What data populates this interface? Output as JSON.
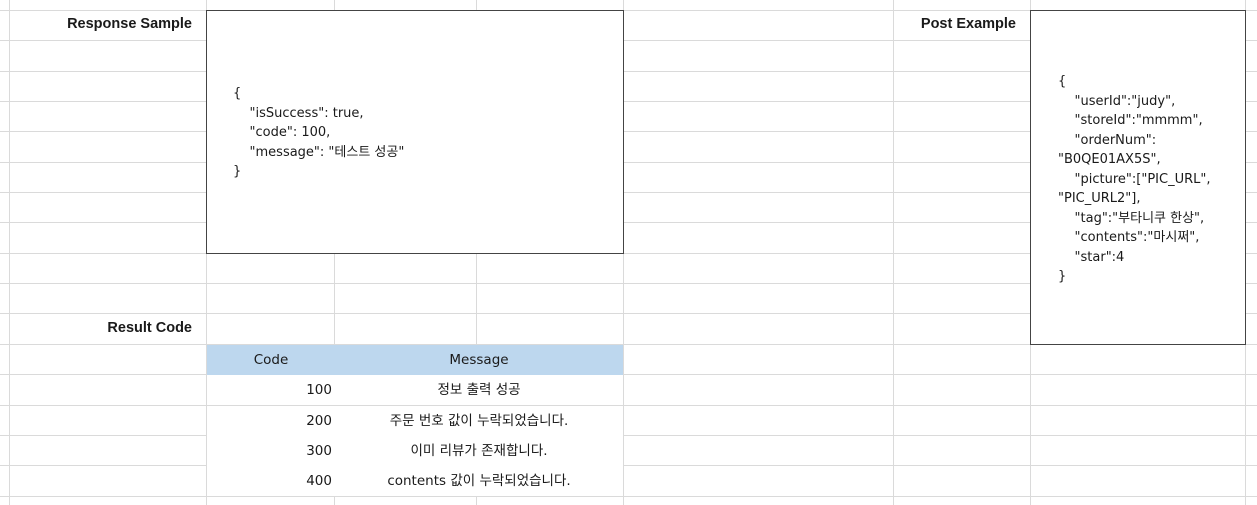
{
  "response_sample": {
    "label": "Response Sample",
    "json_text": "{\n    \"isSuccess\": true,\n    \"code\": 100,\n    \"message\": \"테스트 성공\"\n}"
  },
  "post_example": {
    "label": "Post Example",
    "json_text": "{\n    \"userId\":\"judy\",\n    \"storeId\":\"mmmm\",\n    \"orderNum\":\n\"B0QE01AX5S\",\n    \"picture\":[\"PIC_URL\",\n\"PIC_URL2\"],\n    \"tag\":\"부타니쿠 한상\",\n    \"contents\":\"마시쩌\",\n    \"star\":4\n}"
  },
  "result_code": {
    "label": "Result Code",
    "headers": {
      "code": "Code",
      "message": "Message"
    },
    "rows": [
      {
        "code": "100",
        "message": "정보 출력 성공"
      },
      {
        "code": "200",
        "message": "주문 번호 값이 누락되었습니다."
      },
      {
        "code": "300",
        "message": "이미 리뷰가 존재합니다."
      },
      {
        "code": "400",
        "message": "contents 값이 누락되었습니다."
      }
    ]
  },
  "colors": {
    "header_fill": "#bdd7ee",
    "gridline": "#dadada",
    "box_border": "#444444"
  }
}
